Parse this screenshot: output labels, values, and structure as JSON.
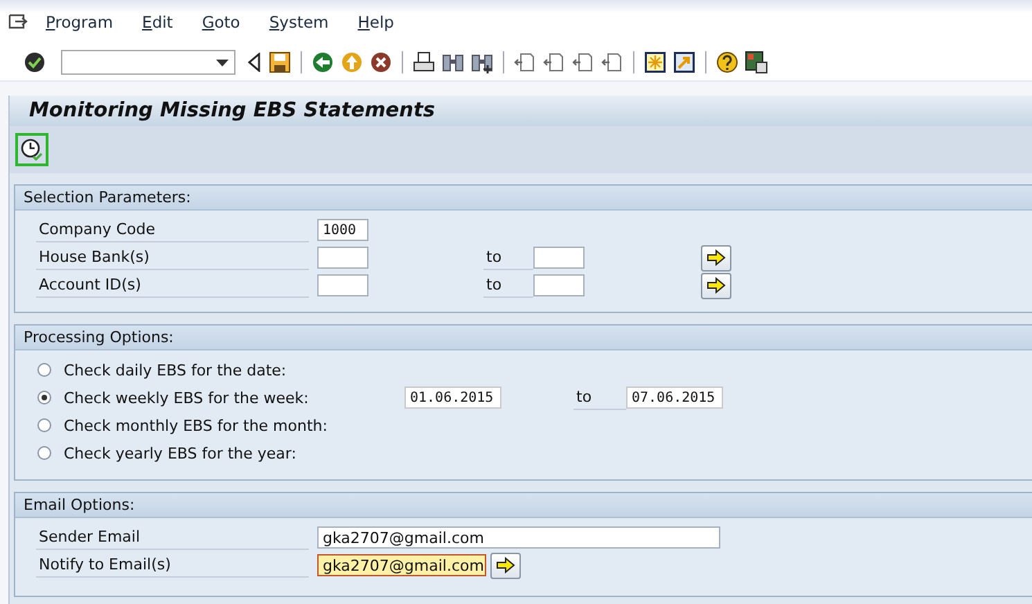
{
  "menu": [
    {
      "label": "Program"
    },
    {
      "label": "Edit"
    },
    {
      "label": "Goto"
    },
    {
      "label": "System"
    },
    {
      "label": "Help"
    }
  ],
  "title": "Monitoring Missing EBS Statements",
  "selection_parameters": {
    "heading": "Selection Parameters:",
    "rows": [
      {
        "kind": "single",
        "label": "Company Code",
        "value": "1000"
      },
      {
        "kind": "range",
        "label": "House Bank(s)",
        "to_label": "to"
      },
      {
        "kind": "range",
        "label": "Account ID(s)",
        "to_label": "to"
      }
    ]
  },
  "processing_options": {
    "heading": "Processing Options:",
    "options": [
      {
        "label": "Check daily EBS for the date:",
        "selected": false
      },
      {
        "label": "Check weekly EBS for the week:",
        "selected": true,
        "from": "01.06.2015",
        "to_label": "to",
        "to": "07.06.2015"
      },
      {
        "label": "Check monthly EBS for the month:",
        "selected": false
      },
      {
        "label": "Check yearly EBS for the year:",
        "selected": false
      }
    ]
  },
  "email_options": {
    "heading": "Email Options:",
    "rows": [
      {
        "kind": "wide",
        "label": "Sender Email",
        "value": "gka2707@gmail.com",
        "focused": false
      },
      {
        "kind": "multi",
        "label": "Notify to Email(s)",
        "value": "gka2707@gmail.com",
        "focused": true
      }
    ]
  }
}
